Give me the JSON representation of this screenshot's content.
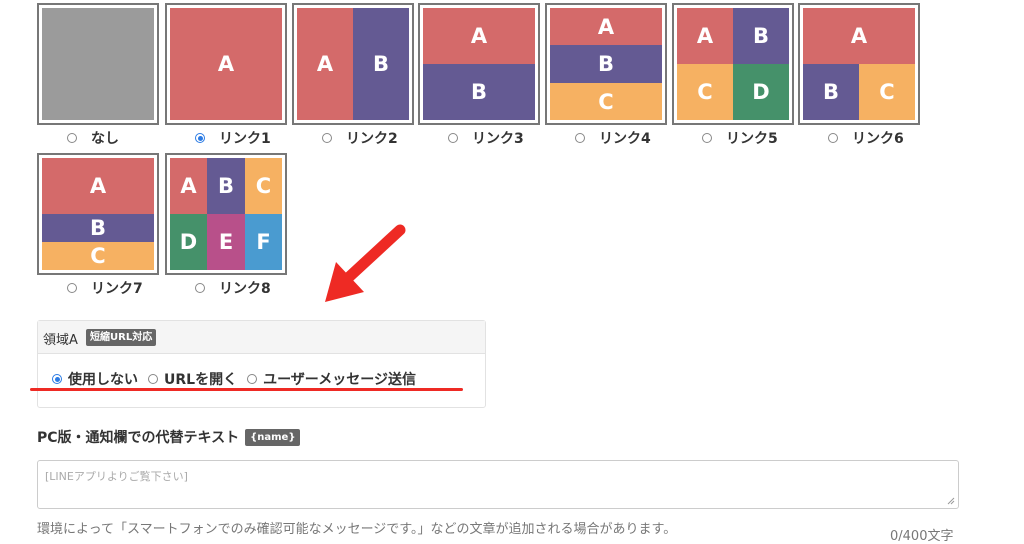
{
  "layouts": [
    {
      "label": "なし",
      "selected": false,
      "cells": []
    },
    {
      "label": "リンク1",
      "selected": true,
      "cells": [
        "A"
      ]
    },
    {
      "label": "リンク2",
      "selected": false,
      "cells": [
        "A",
        "B"
      ]
    },
    {
      "label": "リンク3",
      "selected": false,
      "cells": [
        "A",
        "B"
      ]
    },
    {
      "label": "リンク4",
      "selected": false,
      "cells": [
        "A",
        "B",
        "C"
      ]
    },
    {
      "label": "リンク5",
      "selected": false,
      "cells": [
        "A",
        "B",
        "C",
        "D"
      ]
    },
    {
      "label": "リンク6",
      "selected": false,
      "cells": [
        "A",
        "B",
        "C"
      ]
    },
    {
      "label": "リンク7",
      "selected": false,
      "cells": [
        "A",
        "B",
        "C"
      ]
    },
    {
      "label": "リンク8",
      "selected": false,
      "cells": [
        "A",
        "B",
        "C",
        "D",
        "E",
        "F"
      ]
    }
  ],
  "region": {
    "title": "領域A",
    "badge": "短縮URL対応",
    "options": [
      {
        "label": "使用しない",
        "selected": true
      },
      {
        "label": "URLを開く",
        "selected": false
      },
      {
        "label": "ユーザーメッセージ送信",
        "selected": false
      }
    ]
  },
  "alt_text": {
    "heading": "PC版・通知欄での代替テキスト",
    "badge": "{name}",
    "placeholder": "[LINEアプリよりご覧下さい]",
    "note": "環境によって「スマートフォンでのみ確認可能なメッセージです。」などの文章が追加される場合があります。",
    "counter": "0/400文字"
  },
  "colors": {
    "red": "#d46a6a",
    "purple": "#645a93",
    "orange": "#f6b162",
    "green": "#45916a",
    "pink": "#b8508a",
    "blue": "#4a9bd0",
    "gray": "#9b9b9b",
    "accent": "#2b7be4",
    "arrow": "#ee2a24"
  },
  "icons": {
    "arrow": "red-arrow-icon",
    "underline": "red-underline-annotation",
    "resize": "resize-handle-icon"
  }
}
